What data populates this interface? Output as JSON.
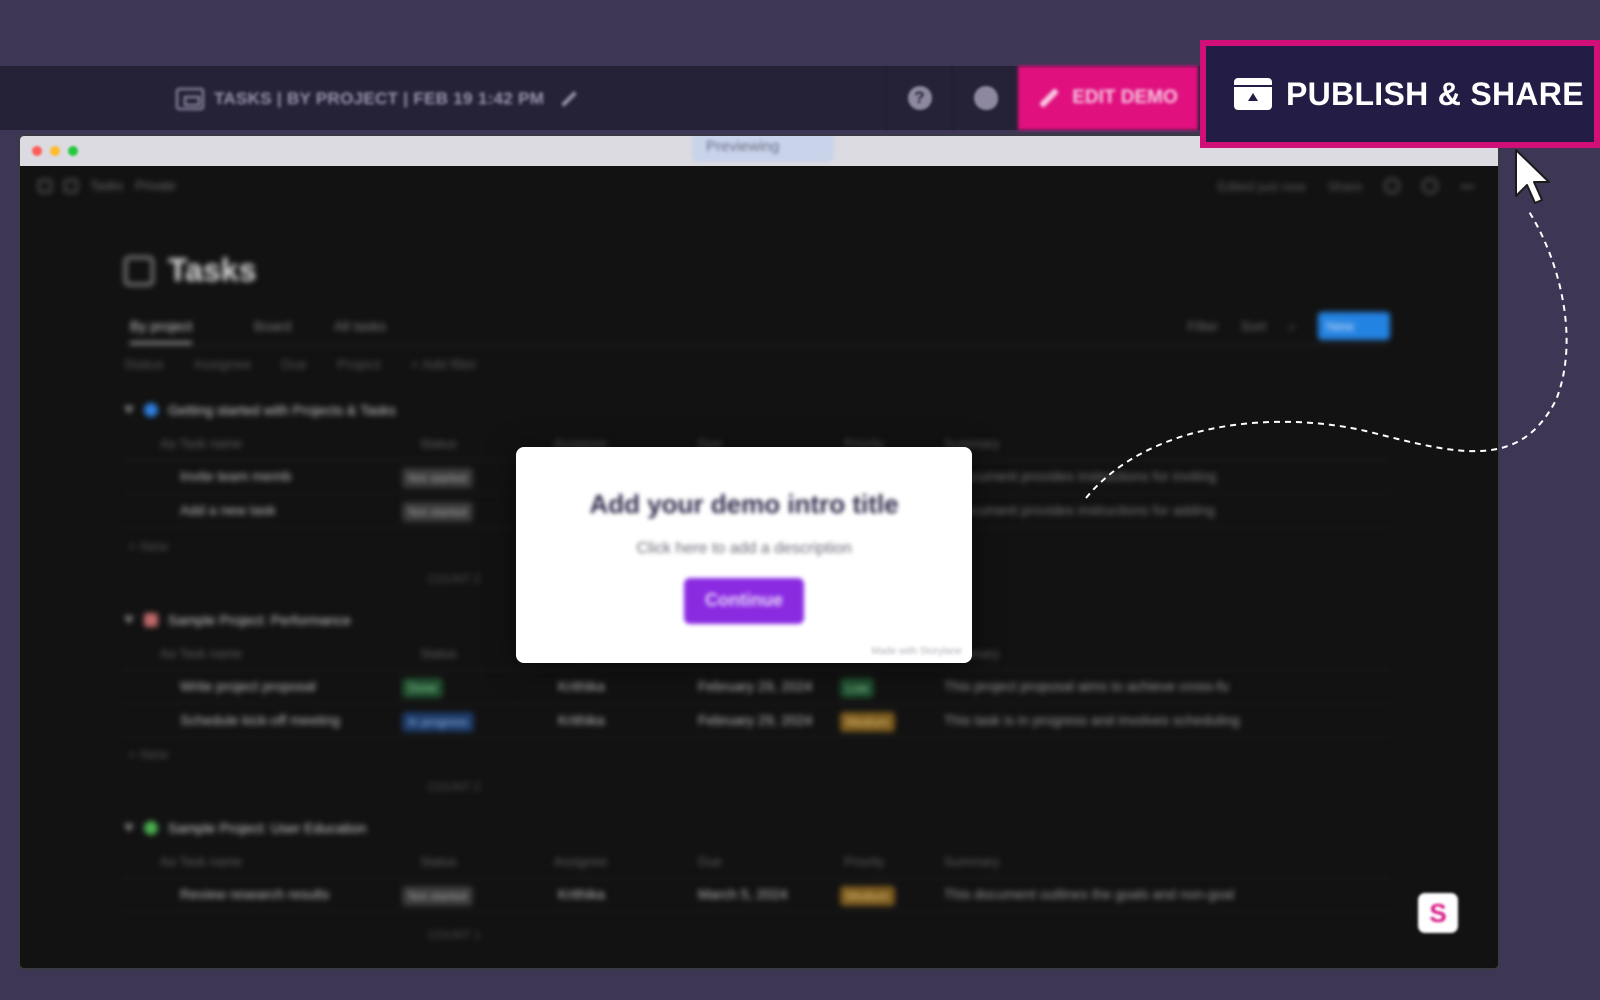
{
  "header": {
    "demo_title": "TASKS | BY PROJECT | FEB 19 1:42 PM",
    "edit_label": "EDIT DEMO",
    "publish_label": "PUBLISH & SHARE"
  },
  "browser": {
    "preview_tab": "Previewing"
  },
  "app": {
    "breadcrumb_page": "Tasks",
    "breadcrumb_access": "Private",
    "edited": "Edited just now",
    "share": "Share",
    "page_title": "Tasks",
    "views": [
      "By project",
      "Board",
      "All tasks"
    ],
    "tools": [
      "Filter",
      "Sort"
    ],
    "new_button": "New",
    "filters": [
      "Status",
      "Assignee",
      "Due",
      "Project",
      "+ Add filter"
    ],
    "columns": [
      "Aa Task name",
      "Status",
      "Assignee",
      "Due",
      "Priority",
      "Summary"
    ],
    "new_row": "+ New",
    "groups": [
      {
        "name": "Getting started with Projects & Tasks",
        "color": "#2f7fe0",
        "count_label": "COUNT 2",
        "tasks": [
          {
            "name": "Invite team memb",
            "status": "Not started",
            "assignee": "",
            "due": "",
            "priority": "",
            "summary": "...document provides instructions for inviting"
          },
          {
            "name": "Add a new task",
            "status": "Not started",
            "assignee": "",
            "due": "",
            "priority": "",
            "summary": "...document provides instructions for adding"
          }
        ]
      },
      {
        "name": "Sample Project: Performance",
        "color": "#c06a6a",
        "count_label": "COUNT 2",
        "tasks": [
          {
            "name": "Write project proposal",
            "status": "Done",
            "assignee": "Krithika",
            "due": "February 29, 2024",
            "priority": "Low",
            "summary": "This project proposal aims to achieve cross-fu"
          },
          {
            "name": "Schedule kick-off meeting",
            "status": "In progress",
            "assignee": "Krithika",
            "due": "February 29, 2024",
            "priority": "Medium",
            "summary": "This task is in progress and involves scheduling"
          }
        ]
      },
      {
        "name": "Sample Project: User Education",
        "color": "#4caf50",
        "count_label": "COUNT 1",
        "tasks": [
          {
            "name": "Review research results",
            "status": "Not started",
            "assignee": "Krithika",
            "due": "March 5, 2024",
            "priority": "Medium",
            "summary": "This document outlines the goals and non-goal"
          }
        ]
      }
    ]
  },
  "modal": {
    "title": "Add your demo intro title",
    "description": "Click here to add a description",
    "button": "Continue",
    "footer": "Made with Storylane"
  },
  "badge": {
    "letter": "S"
  },
  "colors": {
    "accent_pink": "#e0107f",
    "publish_bg": "#231d45",
    "publish_border": "#d10f78",
    "continue_purple": "#8a2be2"
  }
}
